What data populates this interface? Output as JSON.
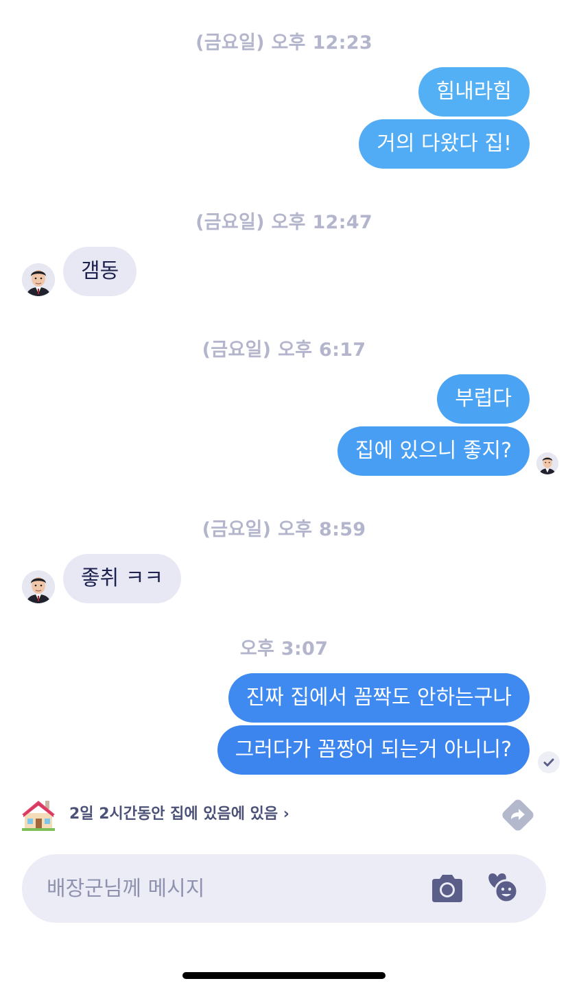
{
  "colors": {
    "outgoing_bubble_start": "#58b2f5",
    "outgoing_bubble_end": "#3d83ee",
    "incoming_bubble": "#e7e8f3",
    "timestamp_text": "#b3b5cc",
    "input_background": "#ebecf5",
    "icon_color": "#5a5e88"
  },
  "messages": [
    {
      "type": "timestamp",
      "text": "(금요일) 오후 12:23"
    },
    {
      "type": "outgoing",
      "text": "힘내라힘"
    },
    {
      "type": "outgoing",
      "text": "거의 다왔다 집!"
    },
    {
      "type": "timestamp",
      "text": "(금요일) 오후 12:47"
    },
    {
      "type": "incoming",
      "text": "갬동",
      "avatar": "memoji-avatar"
    },
    {
      "type": "timestamp",
      "text": "(금요일) 오후 6:17"
    },
    {
      "type": "outgoing",
      "text": "부럽다"
    },
    {
      "type": "outgoing",
      "text": "집에 있으니 좋지?",
      "seen_avatar": "memoji-avatar"
    },
    {
      "type": "timestamp",
      "text": "(금요일) 오후 8:59"
    },
    {
      "type": "incoming",
      "text": "좋취 ㅋㅋ",
      "avatar": "memoji-avatar"
    },
    {
      "type": "timestamp",
      "text": "오후 3:07"
    },
    {
      "type": "outgoing",
      "text": "진짜 집에서 꼼짝도 안하는구나"
    },
    {
      "type": "outgoing",
      "text": "그러다가 꼼짱어 되는거 아니니?",
      "status_icon": "check-icon"
    }
  ],
  "status_bar": {
    "icon": "house-icon",
    "text": "2일 2시간동안 집에 있음에 있음 ›",
    "action_icon": "share-arrow-icon"
  },
  "input": {
    "placeholder": "배장군님께 메시지",
    "value": "",
    "camera_icon": "camera-icon",
    "sticker_icon": "sticker-heart-face-icon"
  }
}
